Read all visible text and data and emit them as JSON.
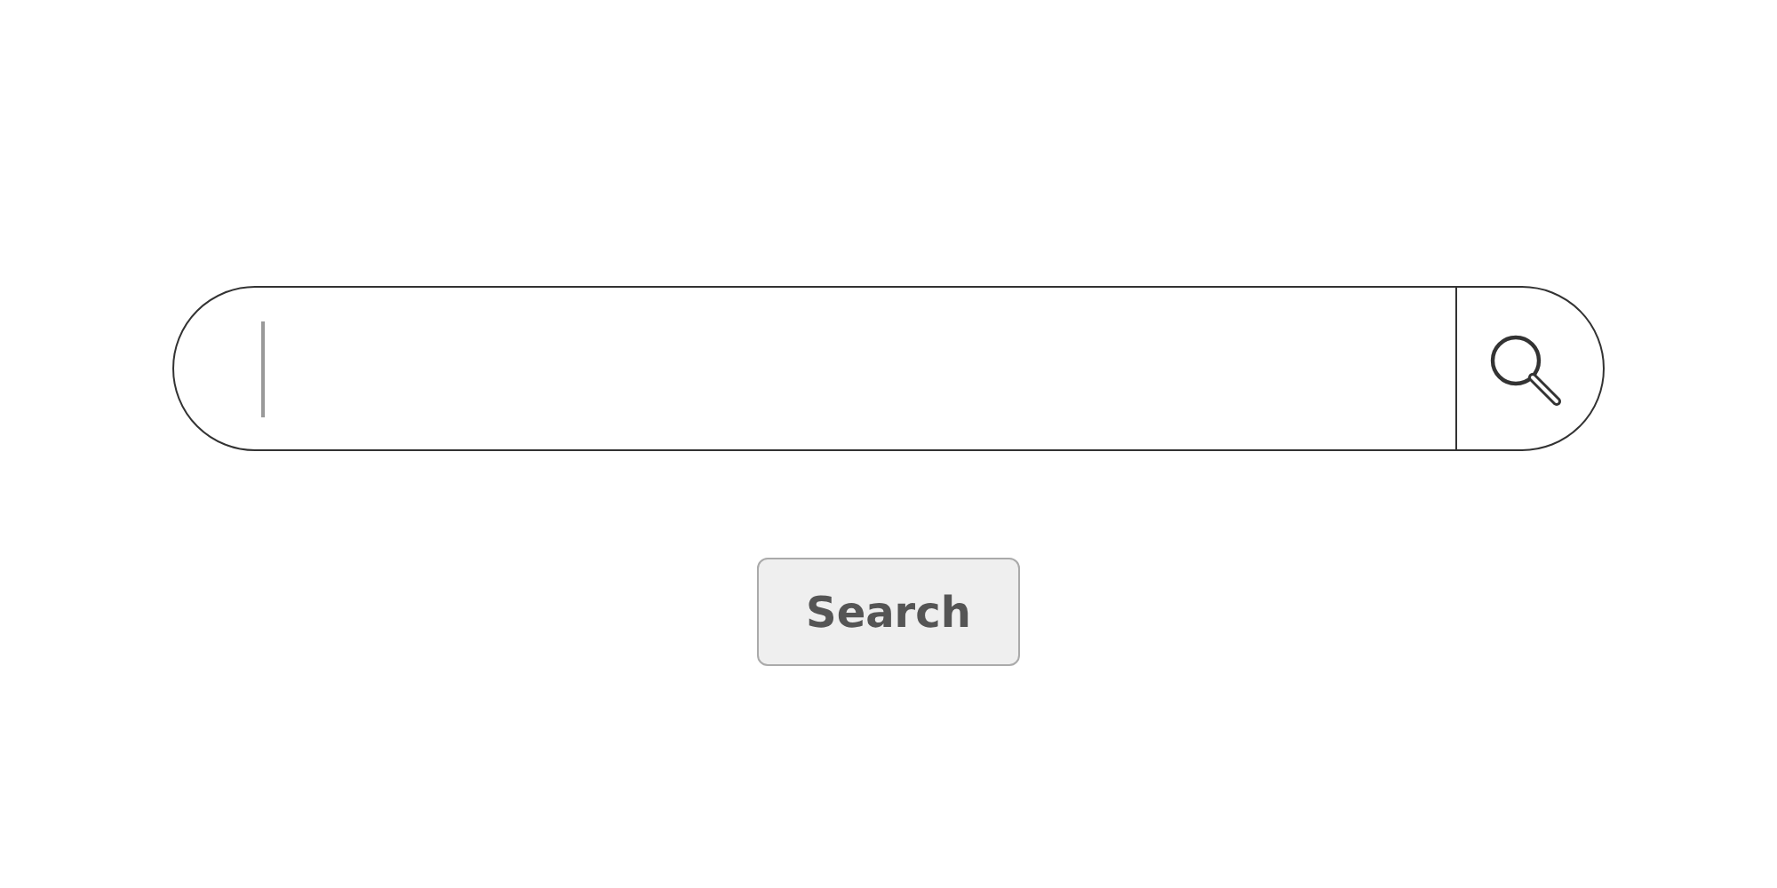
{
  "search_bar": {
    "focused": true
  },
  "button": {
    "label": "Search"
  }
}
